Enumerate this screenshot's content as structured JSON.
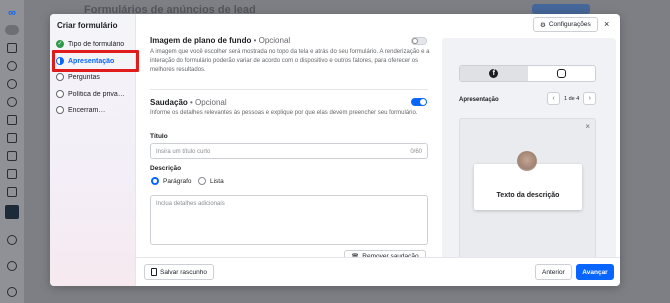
{
  "background": {
    "page_title": "Formulários de anúncios de lead"
  },
  "modal": {
    "sidebar_title": "Criar formulário",
    "steps": [
      {
        "label": "Tipo de formulário",
        "state": "done"
      },
      {
        "label": "Apresentação",
        "state": "active"
      },
      {
        "label": "Perguntas",
        "state": "todo"
      },
      {
        "label": "Política de privacidade",
        "state": "todo"
      },
      {
        "label": "Encerramento",
        "state": "todo"
      }
    ],
    "settings_button": "Configurações",
    "close_label": "×"
  },
  "background_image": {
    "title": "Imagem de plano de fundo",
    "optional": " • Opcional",
    "description": "A imagem que você escolher será mostrada no topo da tela e atrás do seu formulário. A renderização e a interação do formulário poderão variar de acordo com o dispositivo e outros fatores, para oferecer os melhores resultados.",
    "enabled": false
  },
  "greeting": {
    "title": "Saudação",
    "optional": " • Opcional",
    "description": "Informe os detalhes relevantes às pessoas e explique por que elas devem preencher seu formulário.",
    "enabled": true,
    "title_label": "Título",
    "title_placeholder": "Insira um título curto",
    "title_count": "0/60",
    "description_label": "Descrição",
    "format_options": [
      "Parágrafo",
      "Lista"
    ],
    "format_selected": "Parágrafo",
    "description_placeholder": "Inclua detalhes adicionais",
    "remove_button": "Remover saudação"
  },
  "preview": {
    "label": "Apresentação",
    "page": "1 de 4",
    "card_text": "Texto da descrição"
  },
  "footer": {
    "save_draft": "Salvar rascunho",
    "back": "Anterior",
    "next": "Avançar"
  }
}
